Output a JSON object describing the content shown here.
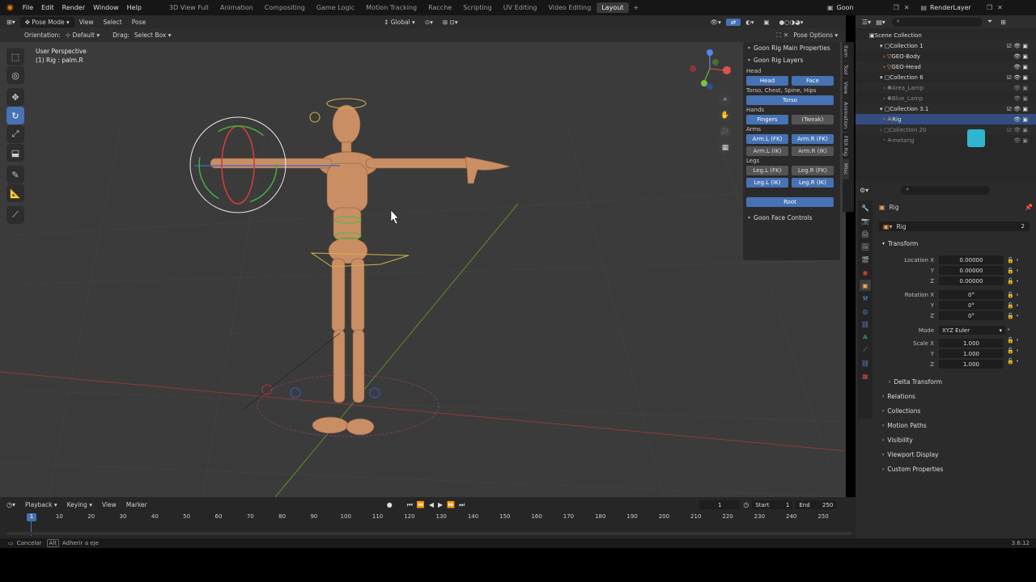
{
  "menu": {
    "items": [
      "File",
      "Edit",
      "Render",
      "Window",
      "Help"
    ]
  },
  "workspaces": [
    "3D View Full",
    "Animation",
    "Compositing",
    "Game Logic",
    "Motion Tracking",
    "Racche",
    "Scripting",
    "UV Editing",
    "Video Editing",
    "Layout"
  ],
  "active_workspace": "Layout",
  "scene": "Goon",
  "view_layer": "RenderLayer",
  "viewport_header": {
    "mode": "Pose Mode",
    "view": "View",
    "select": "Select",
    "pose": "Pose",
    "orientation_label": "Orientation:",
    "orientation": "Default",
    "drag_label": "Drag:",
    "drag": "Select Box",
    "transform": "Global",
    "pose_options": "Pose Options"
  },
  "viewport": {
    "perspective": "User Perspective",
    "object_info": "(1) Rig : palm.R"
  },
  "npanel": {
    "main": "Goon Rig Main Properties",
    "layers": "Goon Rig Layers",
    "head_label": "Head",
    "head": "Head",
    "face": "Face",
    "torso_label": "Torso, Chest, Spine, Hips",
    "torso": "Torso",
    "hands_label": "Hands",
    "fingers": "Fingers",
    "tweak": "(Tweak)",
    "arms_label": "Arms",
    "arm_l_fk": "Arm.L (FK)",
    "arm_r_fk": "Arm.R (FK)",
    "arm_l_ik": "Arm.L (IK)",
    "arm_r_ik": "Arm.R (IK)",
    "legs_label": "Legs",
    "leg_l_fk": "Leg.L (FK)",
    "leg_r_fk": "Leg.R (FK)",
    "leg_l_ik": "Leg.L (IK)",
    "leg_r_ik": "Leg.R (IK)",
    "root": "Root",
    "face_controls": "Goon Face Controls",
    "tabs": [
      "Item",
      "Tool",
      "View",
      "Animation",
      "FBX Rig",
      "Misc"
    ]
  },
  "outliner": {
    "rows": [
      "Scene Collection",
      "Collection 1",
      "GEO-Body",
      "GEO-Head",
      "Collection 6",
      "Area_Lamp",
      "Blue_Lamp",
      "Collection 3.1",
      "Rig",
      "Collection 20",
      "metarig"
    ]
  },
  "properties": {
    "object": "Rig",
    "name": "Rig",
    "users": "2",
    "transform": "Transform",
    "location_label": "Location X",
    "loc": [
      "0.00000",
      "0.00000",
      "0.00000"
    ],
    "rotation_label": "Rotation X",
    "rot": [
      "0°",
      "0°",
      "0°"
    ],
    "y": "Y",
    "z": "Z",
    "mode_label": "Mode",
    "mode": "XYZ Euler",
    "scale_label": "Scale X",
    "scale": [
      "1.000",
      "1.000",
      "1.000"
    ],
    "delta": "Delta Transform",
    "sections": [
      "Relations",
      "Collections",
      "Motion Paths",
      "Visibility",
      "Viewport Display",
      "Custom Properties"
    ]
  },
  "timeline": {
    "playback": "Playback",
    "keying": "Keying",
    "view": "View",
    "marker": "Marker",
    "current": "1",
    "start_label": "Start",
    "start": "1",
    "end_label": "End",
    "end": "250",
    "ticks": [
      "1",
      "10",
      "20",
      "30",
      "40",
      "50",
      "60",
      "70",
      "80",
      "90",
      "100",
      "110",
      "120",
      "130",
      "140",
      "150",
      "160",
      "170",
      "180",
      "190",
      "200",
      "210",
      "220",
      "230",
      "240",
      "250"
    ]
  },
  "status": {
    "cancel": "Cancelar",
    "key": "Alt",
    "snap": "Adherir a eje",
    "version": "3.6.12"
  }
}
